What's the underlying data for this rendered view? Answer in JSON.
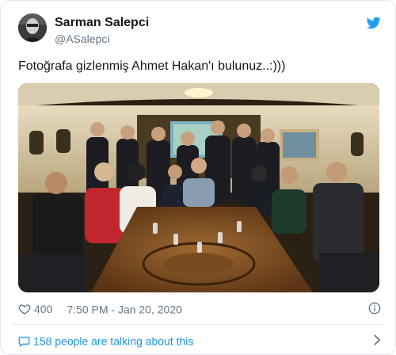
{
  "tweet": {
    "display_name": "Sarman Salepci",
    "handle": "@ASalepci",
    "text": "Fotoğrafa gizlenmiş Ahmet Hakan'ı bulunuz..:)))",
    "likes": "400",
    "timestamp": "7:50 PM - Jan 20, 2020",
    "conversation": "158 people are talking about this"
  },
  "icons": {
    "brand": "twitter-bird-icon",
    "like": "heart-icon",
    "info": "info-icon",
    "reply": "speech-bubble-icon",
    "more": "chevron-right-icon"
  },
  "colors": {
    "brand": "#1da1f2",
    "link": "#1b95e0",
    "muted": "#657786",
    "text": "#14171a",
    "border": "#e1e8ed"
  }
}
